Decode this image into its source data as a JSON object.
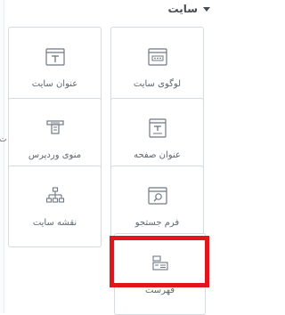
{
  "section": {
    "title": "سایت"
  },
  "edge_mark": "ت",
  "tiles": [
    {
      "label": "لوگوی سایت",
      "icon": "site-logo-icon"
    },
    {
      "label": "عنوان سایت",
      "icon": "site-title-icon"
    },
    {
      "label": "عنوان صفحه",
      "icon": "page-title-icon"
    },
    {
      "label": "منوی وردپرس",
      "icon": "wordpress-menu-icon"
    },
    {
      "label": "فرم جستجو",
      "icon": "search-form-icon"
    },
    {
      "label": "نقشه سایت",
      "icon": "sitemap-icon"
    },
    {
      "label": "فهرست",
      "icon": "table-of-contents-icon"
    }
  ],
  "colors": {
    "highlight": "#e0161d",
    "border": "#d5dadf",
    "text": "#5f6870"
  }
}
